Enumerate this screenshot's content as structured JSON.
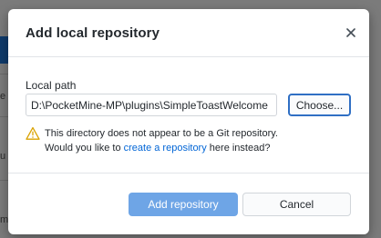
{
  "background": {
    "partial_texts": [
      "e",
      "u",
      "m"
    ]
  },
  "dialog": {
    "title": "Add local repository",
    "close_icon": "close-icon",
    "local_path": {
      "label": "Local path",
      "value": "D:\\PocketMine-MP\\plugins\\SimpleToastWelcome",
      "choose_label": "Choose..."
    },
    "warning": {
      "icon": "warning-icon",
      "line1": "This directory does not appear to be a Git repository.",
      "line2_prefix": "Would you like to ",
      "link_text": "create a repository",
      "line2_suffix": " here instead?"
    },
    "buttons": {
      "primary_label": "Add repository",
      "cancel_label": "Cancel"
    },
    "colors": {
      "primary": "#6ea5e6",
      "focus_border": "#2f6fc4",
      "link": "#0366d6",
      "warning": "#d9a200"
    }
  }
}
